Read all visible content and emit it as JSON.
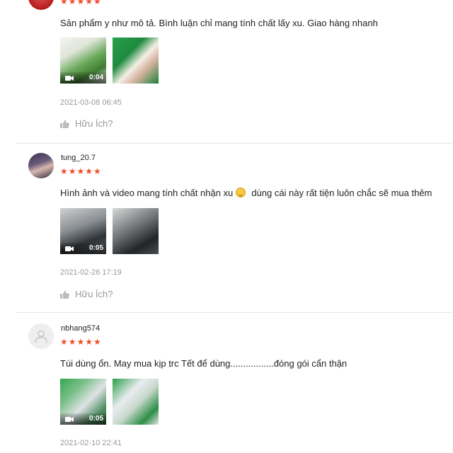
{
  "reviews": [
    {
      "username": "",
      "stars": "★★★★★",
      "comment": "Sản phẩm y như mô tả. Bình luận chỉ mang tính chất lấy xu. Giao hàng nhanh",
      "videos": [
        {
          "duration": "0:04"
        }
      ],
      "date": "2021-03-08 06:45",
      "helpful_label": "Hữu Ích?"
    },
    {
      "username": "tung_20.7",
      "stars": "★★★★★",
      "comment_before": "Hình ảnh và video mang tính chất nhận xu",
      "comment_after": "dùng cái này rất tiện luôn chắc sẽ mua thêm",
      "videos": [
        {
          "duration": "0:05"
        }
      ],
      "date": "2021-02-26 17:19",
      "helpful_label": "Hữu Ích?"
    },
    {
      "username": "nbhang574",
      "stars": "★★★★★",
      "comment": "Túi dùng ổn. May mua kịp trc Tết để dùng.................đóng gói cẩn thận",
      "videos": [
        {
          "duration": "0:05"
        }
      ],
      "date": "2021-02-10 22:41"
    }
  ],
  "colors": {
    "star": "#ee4d2d",
    "meta": "#999999"
  },
  "icons": [
    "video-camera-icon",
    "thumbs-up-icon",
    "default-avatar-icon",
    "smile-emoji-icon"
  ]
}
